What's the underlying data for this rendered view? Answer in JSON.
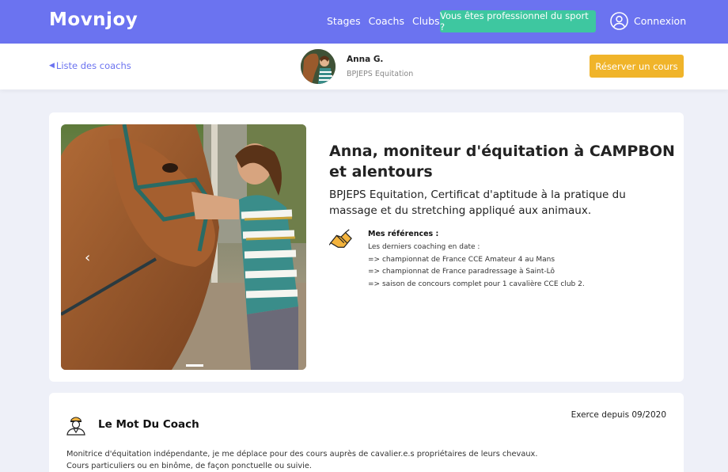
{
  "header": {
    "logo": "Movnjoy",
    "nav": [
      "Stages",
      "Coachs",
      "Clubs"
    ],
    "pro_button": "Vous êtes professionnel du sport ?",
    "login": "Connexion"
  },
  "subbar": {
    "back_link": "Liste des coachs",
    "coach_name": "Anna G.",
    "coach_certification": "BPJEPS Equitation",
    "reserve_button": "Réserver un cours"
  },
  "profile": {
    "title": "Anna, moniteur d'équitation à CAMPBON et alentours",
    "subtitle": "BPJEPS Equitation, Certificat d'aptitude à la pratique du massage et du stretching appliqué aux animaux.",
    "references_title": "Mes références :",
    "references": [
      "Les derniers coaching en date :",
      "=> championnat de France CCE Amateur 4 au Mans",
      "=> championnat de France paradressage à Saint-Lô",
      "=> saison de concours complet pour 1 cavalière CCE club 2."
    ]
  },
  "coach_word": {
    "title": "Le Mot Du Coach",
    "since": "Exerce depuis 09/2020",
    "lines": [
      "Monitrice d'équitation indépendante, je me déplace pour des cours auprès de cavalier.e.s propriétaires de leurs chevaux.",
      "Cours particuliers ou en binôme, de façon ponctuelle ou suivie."
    ]
  },
  "colors": {
    "brand": "#6b73f0",
    "pro_button": "#3ec7a0",
    "reserve_button": "#f0b42a"
  }
}
